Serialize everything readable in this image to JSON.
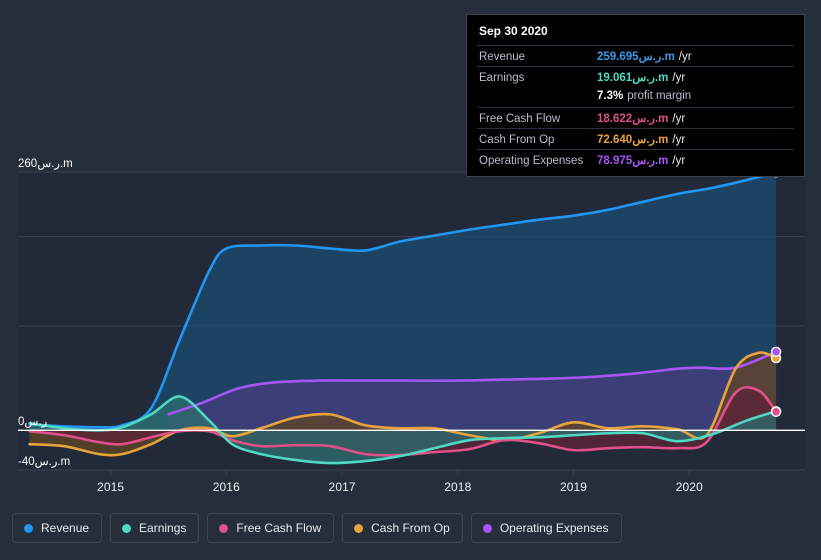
{
  "chart_data": {
    "type": "area",
    "title": "",
    "xlabel": "",
    "ylabel": "",
    "currency": "ر.س",
    "unit": "m",
    "grid": true,
    "legend_position": "bottom",
    "xlim": [
      2014.2,
      2021.0
    ],
    "ylim": [
      -40,
      260
    ],
    "x_ticks": [
      "2015",
      "2016",
      "2017",
      "2018",
      "2019",
      "2020"
    ],
    "x_tick_values": [
      2015,
      2016,
      2017,
      2018,
      2019,
      2020
    ],
    "y_ticks": [
      "260ر.س.m",
      "0ر.س",
      "-40ر.س.m"
    ],
    "y_tick_values": [
      260,
      0,
      -40
    ],
    "gridline_values": [
      260,
      195,
      105,
      0,
      -40
    ],
    "series": [
      {
        "name": "Revenue",
        "color": "#2196f3",
        "fill": "#1d4a6e",
        "x": [
          2014.3,
          2014.6,
          2014.9,
          2015.1,
          2015.35,
          2015.6,
          2015.85,
          2016.0,
          2016.3,
          2016.6,
          2016.9,
          2017.2,
          2017.5,
          2017.8,
          2018.1,
          2018.4,
          2018.7,
          2019.0,
          2019.3,
          2019.6,
          2019.9,
          2020.2,
          2020.5,
          2020.75
        ],
        "values": [
          6,
          4,
          3,
          5,
          22,
          92,
          160,
          183,
          186,
          186,
          183,
          181,
          190,
          196,
          202,
          207,
          212,
          216,
          222,
          230,
          238,
          244,
          252,
          259.695
        ]
      },
      {
        "name": "Earnings",
        "color": "#4fd8c3",
        "fill": "#2d6b6e",
        "x": [
          2014.3,
          2014.6,
          2014.9,
          2015.1,
          2015.35,
          2015.6,
          2015.85,
          2016.05,
          2016.3,
          2016.6,
          2016.9,
          2017.2,
          2017.5,
          2017.8,
          2018.1,
          2018.4,
          2018.7,
          2019.0,
          2019.3,
          2019.6,
          2019.9,
          2020.2,
          2020.5,
          2020.75
        ],
        "values": [
          7,
          2,
          0,
          3,
          16,
          34,
          10,
          -14,
          -24,
          -30,
          -33,
          -31,
          -26,
          -18,
          -10,
          -8,
          -7,
          -5,
          -3,
          -3,
          -11,
          -4,
          10,
          19.061
        ]
      },
      {
        "name": "Free Cash Flow",
        "color": "#e0508a",
        "fill": "#5c2437",
        "x": [
          2014.3,
          2014.6,
          2014.9,
          2015.1,
          2015.35,
          2015.6,
          2015.85,
          2016.05,
          2016.3,
          2016.6,
          2016.9,
          2017.2,
          2017.5,
          2017.8,
          2018.1,
          2018.4,
          2018.7,
          2019.0,
          2019.3,
          2019.6,
          2019.9,
          2020.15,
          2020.4,
          2020.6,
          2020.75
        ],
        "values": [
          -1,
          -5,
          -12,
          -14,
          -7,
          -1,
          -1,
          -10,
          -16,
          -15,
          -16,
          -24,
          -25,
          -22,
          -19,
          -10,
          -13,
          -20,
          -18,
          -17,
          -18,
          -12,
          38,
          40,
          18.622
        ]
      },
      {
        "name": "Cash From Op",
        "color": "#e8a33d",
        "fill": "#5c4426",
        "x": [
          2014.3,
          2014.6,
          2014.9,
          2015.1,
          2015.35,
          2015.6,
          2015.85,
          2016.05,
          2016.3,
          2016.6,
          2016.9,
          2017.2,
          2017.5,
          2017.8,
          2018.1,
          2018.4,
          2018.7,
          2019.0,
          2019.3,
          2019.6,
          2019.9,
          2020.15,
          2020.4,
          2020.6,
          2020.75
        ],
        "values": [
          -14,
          -16,
          -24,
          -24,
          -14,
          0,
          2,
          -6,
          2,
          13,
          16,
          5,
          2,
          2,
          -5,
          -10,
          -3,
          8,
          2,
          4,
          1,
          -5,
          62,
          78,
          72.64
        ]
      },
      {
        "name": "Operating Expenses",
        "color": "#a855f7",
        "fill": "#453f7c",
        "x": [
          2015.5,
          2015.8,
          2016.1,
          2016.4,
          2016.8,
          2017.2,
          2017.6,
          2018.0,
          2018.4,
          2018.8,
          2019.2,
          2019.6,
          2019.9,
          2020.1,
          2020.4,
          2020.75
        ],
        "values": [
          16,
          28,
          42,
          48,
          50,
          50,
          50,
          50,
          51,
          52,
          54,
          58,
          62,
          63,
          63,
          78.975
        ]
      }
    ]
  },
  "tooltip": {
    "date": "Sep 30 2020",
    "rows": [
      {
        "label": "Revenue",
        "value": "259.695ر.س.m",
        "suffix": "/yr",
        "color": "#3a9ae8"
      },
      {
        "label": "Earnings",
        "value": "19.061ر.س.m",
        "suffix": "/yr",
        "color": "#4fd8c3"
      },
      {
        "label": "Free Cash Flow",
        "value": "18.622ر.س.m",
        "suffix": "/yr",
        "color": "#e0508a"
      },
      {
        "label": "Cash From Op",
        "value": "72.640ر.س.m",
        "suffix": "/yr",
        "color": "#e8a33d"
      },
      {
        "label": "Operating Expenses",
        "value": "78.975ر.س.m",
        "suffix": "/yr",
        "color": "#a855f7"
      }
    ],
    "profit_margin_pct": "7.3%",
    "profit_margin_label": "profit margin"
  },
  "legend": {
    "items": [
      {
        "label": "Revenue",
        "color": "#2196f3"
      },
      {
        "label": "Earnings",
        "color": "#4fd8c3"
      },
      {
        "label": "Free Cash Flow",
        "color": "#e0508a"
      },
      {
        "label": "Cash From Op",
        "color": "#e8a33d"
      },
      {
        "label": "Operating Expenses",
        "color": "#a855f7"
      }
    ]
  },
  "colors": {
    "background": "#262d3b",
    "plot_background": "#222938",
    "gridline": "#3b4252",
    "zero_line": "#ffffff",
    "tooltip_background": "#000000"
  }
}
